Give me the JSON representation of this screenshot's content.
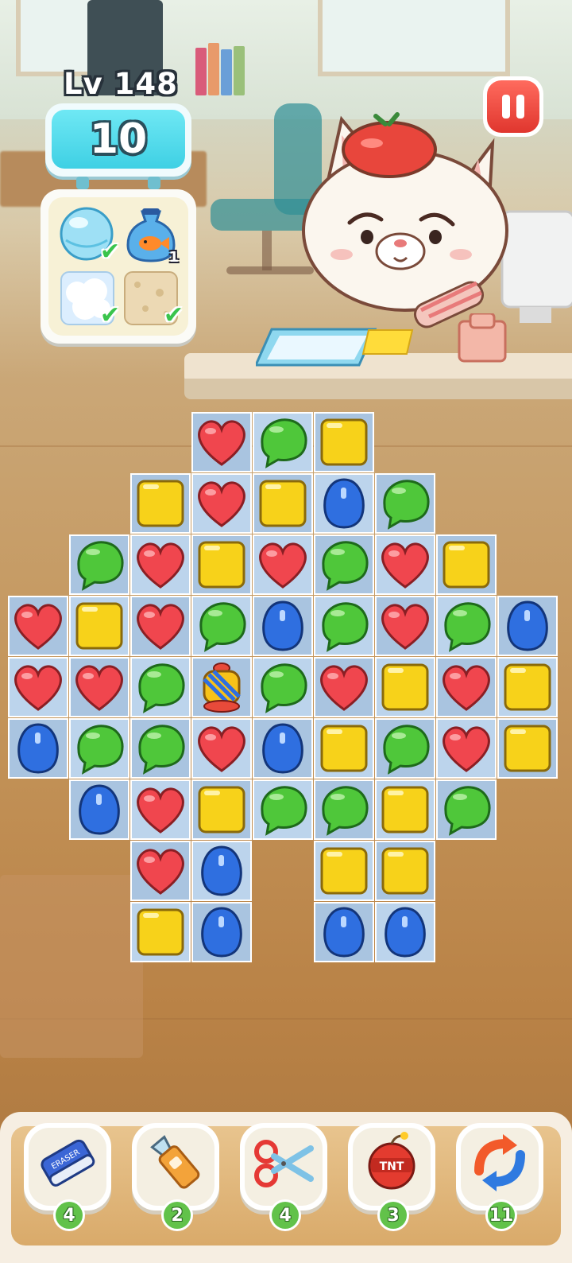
{
  "hud": {
    "level_label": "Lv 148",
    "moves_left": "10",
    "pause_icon": "pause-icon"
  },
  "goals": [
    {
      "name": "bubble",
      "icon": "bubble-icon",
      "status": "done",
      "count": ""
    },
    {
      "name": "goldfish-bag",
      "icon": "goldfish-bag-icon",
      "status": "remaining",
      "count": "1"
    },
    {
      "name": "cloud",
      "icon": "cloud-icon",
      "status": "done",
      "count": ""
    },
    {
      "name": "sand",
      "icon": "sand-icon",
      "status": "done",
      "count": ""
    }
  ],
  "colors": {
    "heart": "#f0464e",
    "blob": "#4fc73a",
    "square": "#f7d21a",
    "drop": "#2f6fe0",
    "board": "#bcd4ec",
    "accent": "#3ed0e4"
  },
  "board": {
    "rows": [
      {
        "start": 3,
        "tiles": [
          "heart",
          "blob",
          "square"
        ]
      },
      {
        "start": 2,
        "tiles": [
          "square",
          "heart",
          "square",
          "drop",
          "blob"
        ]
      },
      {
        "start": 1,
        "tiles": [
          "blob",
          "heart",
          "square",
          "heart",
          "blob",
          "heart",
          "square"
        ]
      },
      {
        "start": 0,
        "tiles": [
          "heart",
          "square",
          "heart",
          "blob",
          "drop",
          "blob",
          "heart",
          "blob",
          "drop"
        ]
      },
      {
        "start": 0,
        "tiles": [
          "heart",
          "heart",
          "blob",
          "lantern",
          "blob",
          "heart",
          "square",
          "heart",
          "square"
        ]
      },
      {
        "start": 0,
        "tiles": [
          "drop",
          "blob",
          "blob",
          "heart",
          "drop",
          "square",
          "blob",
          "heart",
          "square"
        ]
      },
      {
        "start": 1,
        "tiles": [
          "drop",
          "heart",
          "square",
          "blob",
          "blob",
          "square",
          "blob"
        ]
      },
      {
        "start": 2,
        "tiles": [
          "heart",
          "drop",
          null,
          "square",
          "square"
        ]
      },
      {
        "start": 2,
        "tiles": [
          "square",
          "drop",
          null,
          "drop",
          "drop"
        ]
      }
    ]
  },
  "tools": [
    {
      "name": "eraser",
      "icon": "eraser-icon",
      "count": "4",
      "icon_text": "ERASER"
    },
    {
      "name": "box-cutter",
      "icon": "box-cutter-icon",
      "count": "2"
    },
    {
      "name": "scissors",
      "icon": "scissors-icon",
      "count": "4"
    },
    {
      "name": "tnt",
      "icon": "tnt-icon",
      "count": "3",
      "icon_text": "TNT"
    },
    {
      "name": "shuffle",
      "icon": "shuffle-icon",
      "count": "11"
    }
  ]
}
